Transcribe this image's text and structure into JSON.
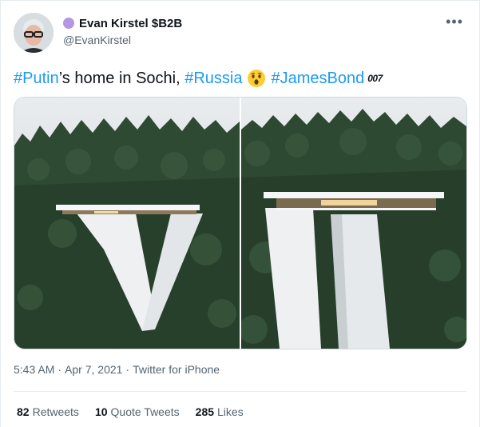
{
  "author": {
    "display_name": "Evan Kirstel $B2B",
    "handle": "@EvanKirstel",
    "status_dot_color": "#b596e3"
  },
  "more_icon": "•••",
  "tweet": {
    "hashtag_1": "#Putin",
    "text_1": "’s home in Sochi, ",
    "hashtag_2": "#Russia",
    "emoji": "astonished-face",
    "hashtag_3": "#JamesBond",
    "logo_text": "007"
  },
  "meta": {
    "time": "5:43 AM",
    "sep": "·",
    "date": "Apr 7, 2021",
    "source": "Twitter for iPhone"
  },
  "stats": {
    "retweets_count": "82",
    "retweets_label": "Retweets",
    "quotes_count": "10",
    "quotes_label": "Quote Tweets",
    "likes_count": "285",
    "likes_label": "Likes"
  },
  "colors": {
    "link": "#1d9bf0",
    "text": "#0f1419",
    "secondary": "#536471"
  }
}
